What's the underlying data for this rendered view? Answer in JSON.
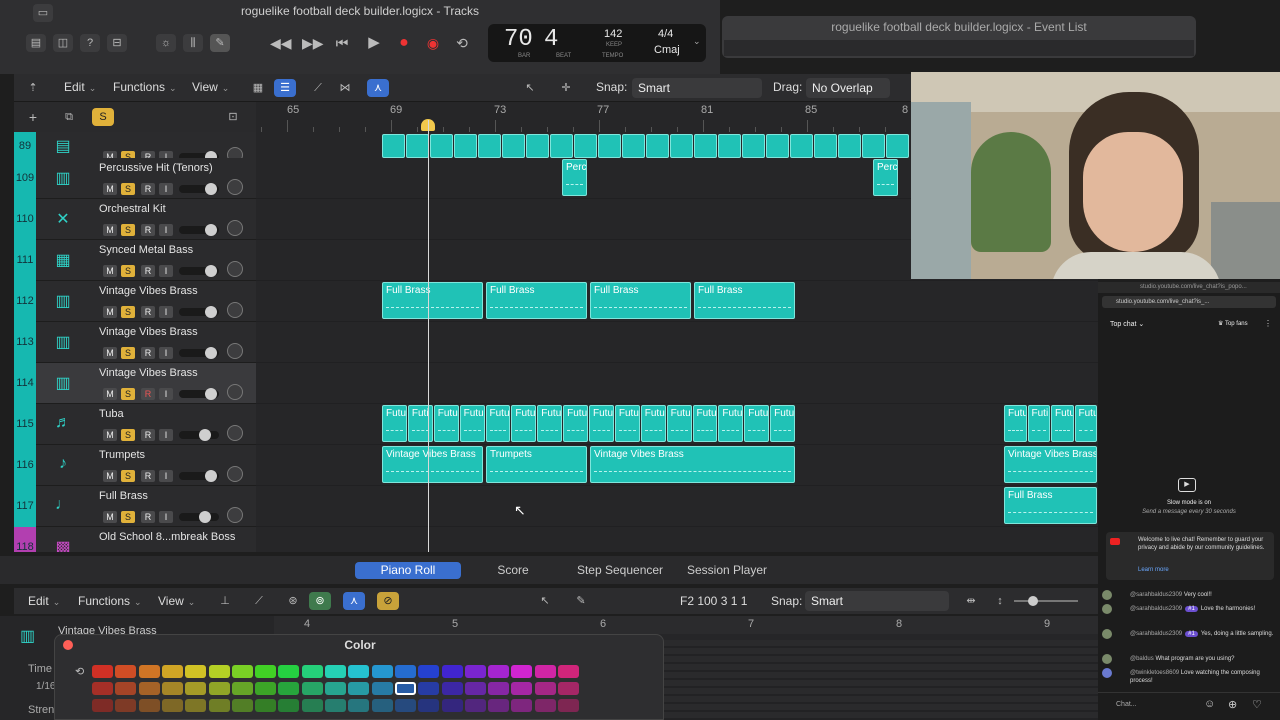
{
  "window": {
    "title": "roguelike football deck builder.logicx - Tracks",
    "event_list_title": "roguelike football deck builder.logicx - Event List"
  },
  "lcd": {
    "bar": "70",
    "beat": "4",
    "bar_label": "BAR",
    "beat_label": "BEAT",
    "tempo": "142",
    "tempo_keep": "KEEP",
    "tempo_label": "TEMPO",
    "signature": "4/4",
    "key": "Cmaj"
  },
  "toolbar": {
    "edit": "Edit",
    "functions": "Functions",
    "view": "View",
    "snap_label": "Snap:",
    "snap_value": "Smart",
    "drag_label": "Drag:",
    "drag_value": "No Overlap",
    "solo_btn": "S"
  },
  "ruler": [
    "65",
    "69",
    "73",
    "77",
    "81",
    "85",
    "8"
  ],
  "tracks": [
    {
      "num": "89",
      "name": "",
      "icon": "folder-icon"
    },
    {
      "num": "109",
      "name": "Percussive Hit (Tenors)",
      "icon": "keyboard-icon"
    },
    {
      "num": "110",
      "name": "Orchestral Kit",
      "icon": "drumsticks-icon"
    },
    {
      "num": "111",
      "name": "Synced Metal Bass",
      "icon": "synth-icon"
    },
    {
      "num": "112",
      "name": "Vintage Vibes Brass",
      "icon": "keyboard-icon"
    },
    {
      "num": "113",
      "name": "Vintage Vibes Brass",
      "icon": "keyboard-icon"
    },
    {
      "num": "114",
      "name": "Vintage Vibes Brass",
      "icon": "keyboard-icon"
    },
    {
      "num": "115",
      "name": "Tuba",
      "icon": "tuba-icon"
    },
    {
      "num": "116",
      "name": "Trumpets",
      "icon": "trumpet-icon"
    },
    {
      "num": "117",
      "name": "Full Brass",
      "icon": "trombone-icon"
    },
    {
      "num": "118",
      "name": "Old School 8...mbreak Boss",
      "icon": "drum-machine-icon"
    }
  ],
  "track_buttons": {
    "mute": "M",
    "solo": "S",
    "record": "R",
    "input": "I"
  },
  "regions": {
    "perc": "Perc",
    "full_brass": "Full Brass",
    "futu": "Futu",
    "futi": "Futi",
    "vintage": "Vintage Vibes Brass",
    "trumpets": "Trumpets"
  },
  "editor_tabs": [
    "Piano Roll",
    "Score",
    "Step Sequencer",
    "Session Player"
  ],
  "editor": {
    "edit": "Edit",
    "functions": "Functions",
    "view": "View",
    "position": "F2  100 3 1 1",
    "snap_label": "Snap:",
    "snap_value": "Smart",
    "region_name": "Vintage Vibes Brass",
    "ruler": [
      "4",
      "5",
      "6",
      "7",
      "8",
      "9"
    ],
    "side_time": "Time",
    "side_div": "1/16",
    "side_str": "Stren"
  },
  "color_panel": {
    "title": "Color"
  },
  "chat": {
    "url": "studio.youtube.com/live_chat?is_popo...",
    "url2": "studio.youtube.com/live_chat?is_...",
    "top_chat": "Top chat",
    "top_fans": "Top fans",
    "slow_title": "Slow mode is on",
    "slow_sub": "Send a message every 30 seconds",
    "welcome": "Welcome to live chat! Remember to guard your privacy and abide by our community guidelines.",
    "learn_more": "Learn more",
    "messages": [
      {
        "user": "@sarahbaldus2309",
        "badge": "",
        "text": "Very cool!!"
      },
      {
        "user": "@sarahbaldus2309",
        "badge": "#1",
        "text": "Love the harmonies!"
      },
      {
        "user": "@sarahbaldus2309",
        "badge": "#1",
        "text": "Yes, doing a little sampling."
      },
      {
        "user": "@baldus",
        "badge": "",
        "text": "What program are you using?"
      },
      {
        "user": "@twinkletoes8609",
        "badge": "",
        "text": "Love watching the composing process!"
      }
    ],
    "input_placeholder": "Chat..."
  },
  "colors": {
    "accent": "#20c2b6",
    "track_num": "#16b8b0",
    "solo": "#e0b13a",
    "tab_active": "#3a6fcf"
  }
}
